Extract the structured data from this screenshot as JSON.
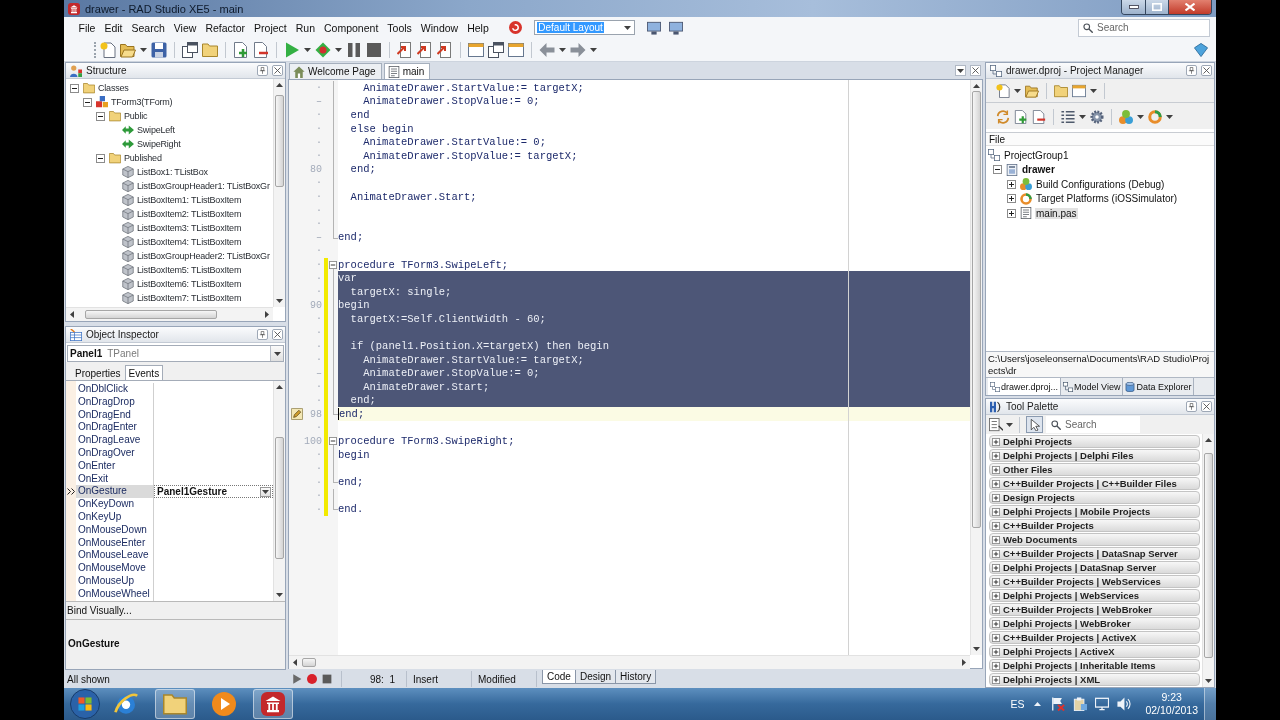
{
  "window": {
    "title": "drawer - RAD Studio XE5 - main"
  },
  "menu": {
    "items": [
      "File",
      "Edit",
      "Search",
      "View",
      "Refactor",
      "Project",
      "Run",
      "Component",
      "Tools",
      "Window",
      "Help"
    ],
    "layout": {
      "value": "Default Layout",
      "highlighted": true
    },
    "search": {
      "placeholder": "Search"
    }
  },
  "structure": {
    "title": "Structure",
    "tree": [
      {
        "label": "Classes",
        "kind": "folder",
        "expanded": true,
        "children": [
          {
            "label": "TForm3(TForm)",
            "kind": "class",
            "expanded": true,
            "children": [
              {
                "label": "Public",
                "kind": "folder",
                "expanded": true,
                "children": [
                  {
                    "label": "SwipeLeft",
                    "kind": "method"
                  },
                  {
                    "label": "SwipeRight",
                    "kind": "method"
                  }
                ]
              },
              {
                "label": "Published",
                "kind": "folder",
                "expanded": true,
                "children": [
                  {
                    "label": "ListBox1: TListBox",
                    "kind": "component"
                  },
                  {
                    "label": "ListBoxGroupHeader1: TListBoxGr",
                    "kind": "component"
                  },
                  {
                    "label": "ListBoxItem1: TListBoxItem",
                    "kind": "component"
                  },
                  {
                    "label": "ListBoxItem2: TListBoxItem",
                    "kind": "component"
                  },
                  {
                    "label": "ListBoxItem3: TListBoxItem",
                    "kind": "component"
                  },
                  {
                    "label": "ListBoxItem4: TListBoxItem",
                    "kind": "component"
                  },
                  {
                    "label": "ListBoxGroupHeader2: TListBoxGr",
                    "kind": "component"
                  },
                  {
                    "label": "ListBoxItem5: TListBoxItem",
                    "kind": "component"
                  },
                  {
                    "label": "ListBoxItem6: TListBoxItem",
                    "kind": "component"
                  },
                  {
                    "label": "ListBoxItem7: TListBoxItem",
                    "kind": "component"
                  }
                ]
              }
            ]
          }
        ]
      }
    ]
  },
  "object_inspector": {
    "title": "Object Inspector",
    "object": {
      "name": "Panel1",
      "type": "TPanel"
    },
    "tabs": [
      {
        "label": "Properties",
        "selected": false
      },
      {
        "label": "Events",
        "selected": true
      }
    ],
    "events": [
      {
        "name": "OnDblClick",
        "selected": false
      },
      {
        "name": "OnDragDrop",
        "selected": false
      },
      {
        "name": "OnDragEnd",
        "selected": false
      },
      {
        "name": "OnDragEnter",
        "selected": false
      },
      {
        "name": "OnDragLeave",
        "selected": false
      },
      {
        "name": "OnDragOver",
        "selected": false
      },
      {
        "name": "OnEnter",
        "selected": false
      },
      {
        "name": "OnExit",
        "selected": false
      },
      {
        "name": "OnGesture",
        "value": "Panel1Gesture",
        "selected": true
      },
      {
        "name": "OnKeyDown",
        "selected": false
      },
      {
        "name": "OnKeyUp",
        "selected": false
      },
      {
        "name": "OnMouseDown",
        "selected": false
      },
      {
        "name": "OnMouseEnter",
        "selected": false
      },
      {
        "name": "OnMouseLeave",
        "selected": false
      },
      {
        "name": "OnMouseMove",
        "selected": false
      },
      {
        "name": "OnMouseUp",
        "selected": false
      },
      {
        "name": "OnMouseWheel",
        "selected": false
      }
    ],
    "bind_visually": "Bind Visually...",
    "description": "OnGesture",
    "status": "All shown"
  },
  "editor": {
    "tabs": [
      {
        "label": "Welcome Page",
        "kind": "welcome",
        "selected": false
      },
      {
        "label": "main",
        "kind": "unit",
        "selected": true
      }
    ],
    "lines": [
      {
        "mark": "·",
        "text": "    AnimateDrawer.StartValue:= targetX;",
        "kind": "body",
        "selected": false,
        "current": false,
        "modified": false
      },
      {
        "mark": "–",
        "text": "    AnimateDrawer.StopValue:= 0;",
        "kind": "body",
        "selected": false,
        "current": false,
        "modified": false
      },
      {
        "mark": "·",
        "text": "  end",
        "kind": "body",
        "selected": false,
        "current": false,
        "modified": false
      },
      {
        "mark": "·",
        "text": "  else begin",
        "kind": "body",
        "selected": false,
        "current": false,
        "modified": false
      },
      {
        "mark": "·",
        "text": "    AnimateDrawer.StartValue:= 0;",
        "kind": "body",
        "selected": false,
        "current": false,
        "modified": false
      },
      {
        "mark": "·",
        "text": "    AnimateDrawer.StopValue:= targetX;",
        "kind": "body",
        "selected": false,
        "current": false,
        "modified": false
      },
      {
        "number": "80",
        "text": "  end;",
        "kind": "body",
        "selected": false,
        "current": false,
        "modified": false
      },
      {
        "mark": "·",
        "kind": "body",
        "selected": false,
        "current": false,
        "modified": false
      },
      {
        "mark": "·",
        "text": "  AnimateDrawer.Start;",
        "kind": "body",
        "selected": false,
        "current": false,
        "modified": false
      },
      {
        "mark": "·",
        "kind": "body",
        "selected": false,
        "current": false,
        "modified": false
      },
      {
        "mark": "·",
        "kind": "body",
        "selected": false,
        "current": false,
        "modified": false
      },
      {
        "mark": "–",
        "text": "end;",
        "kind": "end",
        "selected": false,
        "current": false,
        "modified": false
      },
      {
        "mark": "·",
        "kind": "plain",
        "selected": false,
        "current": false,
        "modified": false
      },
      {
        "mark": "·",
        "text": "procedure TForm3.SwipeLeft;",
        "kind": "start",
        "selected": false,
        "current": false,
        "modified": true
      },
      {
        "mark": "·",
        "text": "var",
        "kind": "body",
        "selected": true,
        "current": false,
        "modified": true
      },
      {
        "mark": "·",
        "text": "  targetX: single;",
        "kind": "body",
        "selected": true,
        "current": false,
        "modified": true
      },
      {
        "number": "90",
        "text": "begin",
        "kind": "body",
        "selected": true,
        "current": false,
        "modified": true
      },
      {
        "mark": "·",
        "text": "  targetX:=Self.ClientWidth - 60;",
        "kind": "body",
        "selected": true,
        "current": false,
        "modified": true
      },
      {
        "mark": "·",
        "kind": "body",
        "selected": true,
        "current": false,
        "modified": true
      },
      {
        "mark": "·",
        "text": "  if (panel1.Position.X=targetX) then begin",
        "kind": "body",
        "selected": true,
        "current": false,
        "modified": true
      },
      {
        "mark": "·",
        "text": "    AnimateDrawer.StartValue:= targetX;",
        "kind": "body",
        "selected": true,
        "current": false,
        "modified": true
      },
      {
        "mark": "–",
        "text": "    AnimateDrawer.StopValue:= 0;",
        "kind": "body",
        "selected": true,
        "current": false,
        "modified": true
      },
      {
        "mark": "·",
        "text": "    AnimateDrawer.Start;",
        "kind": "body",
        "selected": true,
        "current": false,
        "modified": true
      },
      {
        "mark": "·",
        "text": "  end;",
        "kind": "body",
        "selected": true,
        "current": false,
        "modified": true
      },
      {
        "number": "98",
        "text": "end;",
        "kind": "end",
        "selected": false,
        "current": true,
        "modified": true,
        "gutter_icon": true
      },
      {
        "mark": "·",
        "kind": "plain",
        "selected": false,
        "current": false,
        "modified": true
      },
      {
        "number": "100",
        "text": "procedure TForm3.SwipeRight;",
        "kind": "start",
        "selected": false,
        "current": false,
        "modified": true
      },
      {
        "mark": "·",
        "text": "begin",
        "kind": "body",
        "selected": false,
        "current": false,
        "modified": true
      },
      {
        "mark": "·",
        "kind": "body",
        "selected": false,
        "current": false,
        "modified": true
      },
      {
        "mark": "·",
        "text": "end;",
        "kind": "end",
        "selected": false,
        "current": false,
        "modified": true
      },
      {
        "mark": "·",
        "kind": "body",
        "selected": false,
        "current": false,
        "modified": true
      },
      {
        "mark": "·",
        "text": "end.",
        "kind": "end",
        "selected": false,
        "current": false,
        "modified": true
      }
    ],
    "status": {
      "position": "98:  1",
      "mode": "Insert",
      "state": "Modified"
    },
    "views": [
      {
        "label": "Code",
        "selected": true
      },
      {
        "label": "Design",
        "selected": false
      },
      {
        "label": "History",
        "selected": false
      }
    ]
  },
  "project_manager": {
    "title": "drawer.dproj - Project Manager",
    "column": "File",
    "tree": [
      {
        "label": "ProjectGroup1",
        "kind": "group",
        "children": [
          {
            "label": "drawer",
            "kind": "project",
            "active": true,
            "expanded": true,
            "children": [
              {
                "label": "Build Configurations (Debug)",
                "kind": "configurations",
                "expanded": false,
                "selected": false
              },
              {
                "label": "Target Platforms (iOSSimulator)",
                "kind": "platforms",
                "expanded": false,
                "selected": false
              },
              {
                "label": "main.pas",
                "kind": "file",
                "expanded": false,
                "selected": true
              }
            ]
          }
        ]
      }
    ],
    "path": "C:\\Users\\joseleonserna\\Documents\\RAD Studio\\Projects\\dr",
    "tabs": [
      {
        "label": "drawer.dproj...",
        "kind": "project",
        "selected": true
      },
      {
        "label": "Model View",
        "kind": "model",
        "selected": false
      },
      {
        "label": "Data Explorer",
        "kind": "data",
        "selected": false
      }
    ]
  },
  "tool_palette": {
    "title": "Tool Palette",
    "pointer_pressed": true,
    "search": {
      "placeholder": "Search"
    },
    "categories": [
      {
        "label": "Delphi Projects",
        "expanded": false
      },
      {
        "label": "Delphi Projects | Delphi Files",
        "expanded": false
      },
      {
        "label": "Other Files",
        "expanded": false
      },
      {
        "label": "C++Builder Projects | C++Builder Files",
        "expanded": false
      },
      {
        "label": "Design Projects",
        "expanded": false
      },
      {
        "label": "Delphi Projects | Mobile Projects",
        "expanded": false
      },
      {
        "label": "C++Builder Projects",
        "expanded": false
      },
      {
        "label": "Web Documents",
        "expanded": false
      },
      {
        "label": "C++Builder Projects | DataSnap Server",
        "expanded": false
      },
      {
        "label": "Delphi Projects | DataSnap Server",
        "expanded": false
      },
      {
        "label": "C++Builder Projects | WebServices",
        "expanded": false
      },
      {
        "label": "Delphi Projects | WebServices",
        "expanded": false
      },
      {
        "label": "C++Builder Projects | WebBroker",
        "expanded": false
      },
      {
        "label": "Delphi Projects | WebBroker",
        "expanded": false
      },
      {
        "label": "C++Builder Projects | ActiveX",
        "expanded": false
      },
      {
        "label": "Delphi Projects | ActiveX",
        "expanded": false
      },
      {
        "label": "Delphi Projects | Inheritable Items",
        "expanded": false
      },
      {
        "label": "Delphi Projects | XML",
        "expanded": false
      }
    ]
  },
  "taskbar": {
    "apps": [
      {
        "kind": "browser",
        "open": false
      },
      {
        "kind": "folder",
        "open": true
      },
      {
        "kind": "media",
        "open": false
      },
      {
        "kind": "ide",
        "open": true
      }
    ],
    "language": "ES",
    "time": "9:23",
    "date": "02/10/2013"
  }
}
